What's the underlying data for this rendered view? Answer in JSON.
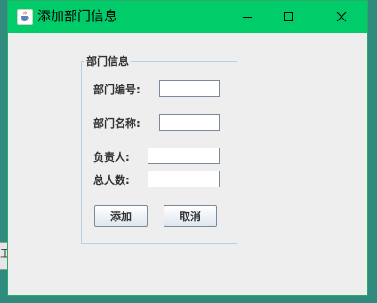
{
  "window": {
    "title": "添加部门信息",
    "icon": "java-cup-icon"
  },
  "background": {
    "edge_text": "工"
  },
  "form": {
    "group_title": "部门信息",
    "fields": [
      {
        "label": "部门编号:",
        "value": ""
      },
      {
        "label": "部门名称:",
        "value": ""
      },
      {
        "label": "负责人:",
        "value": ""
      },
      {
        "label": "总人数:",
        "value": ""
      }
    ],
    "buttons": {
      "add": "添加",
      "cancel": "取消"
    }
  },
  "colors": {
    "titlebar": "#00cc6a",
    "window_bg": "#eeeeee",
    "desktop": "#2e8b7d"
  }
}
